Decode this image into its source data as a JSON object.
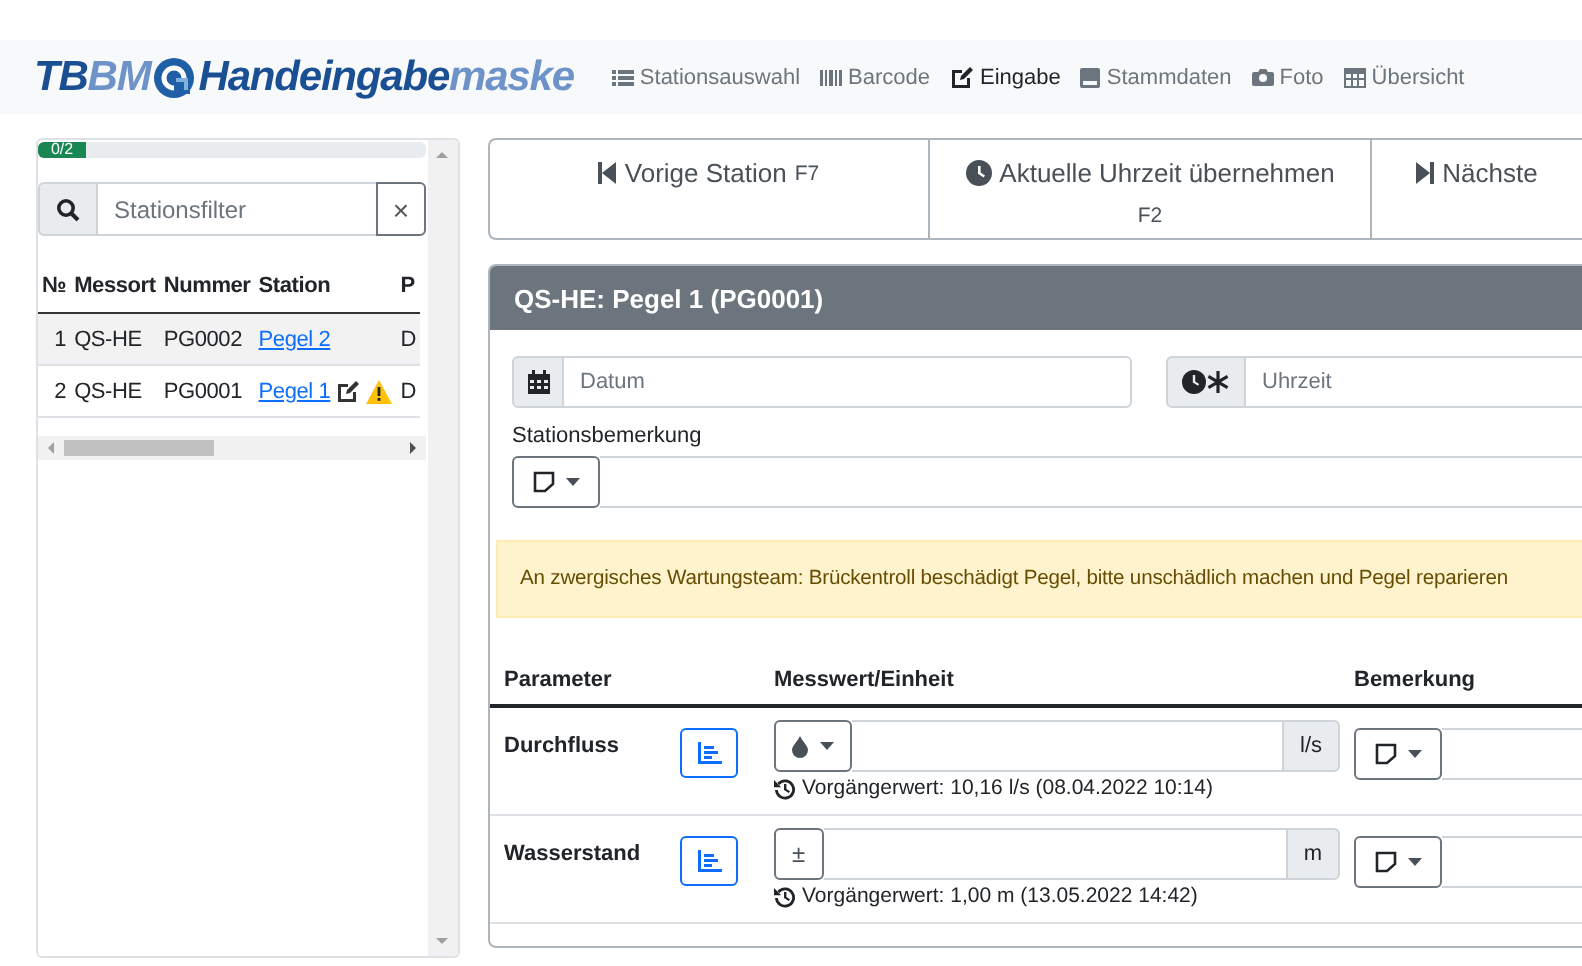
{
  "logo": {
    "brand": [
      {
        "text": "TB",
        "light": false
      },
      {
        "text": "BM",
        "light": true
      }
    ],
    "title": [
      {
        "text": "Handeingabe",
        "light": false
      },
      {
        "text": "maske",
        "light": true
      }
    ]
  },
  "nav": [
    {
      "label": "Stationsauswahl",
      "selected": false
    },
    {
      "label": "Barcode",
      "selected": false
    },
    {
      "label": "Eingabe",
      "selected": true
    },
    {
      "label": "Stammdaten",
      "selected": false
    },
    {
      "label": "Foto",
      "selected": false
    },
    {
      "label": "Übersicht",
      "selected": false
    }
  ],
  "sidebar": {
    "progress": {
      "label": "0/2"
    },
    "search": {
      "placeholder": "Stationsfilter",
      "clear": "×"
    },
    "columns": [
      "№",
      "Messort",
      "Nummer",
      "Station",
      "P"
    ],
    "rows": [
      {
        "no": "1",
        "messort": "QS-HE",
        "nummer": "PG0002",
        "station": "Pegel 2",
        "column_5": "D",
        "edited": false,
        "warning": false
      },
      {
        "no": "2",
        "messort": "QS-HE",
        "nummer": "PG0001",
        "station": "Pegel 1",
        "column_5": "D",
        "edited": true,
        "warning": true
      }
    ]
  },
  "actions": [
    {
      "kind": "prev",
      "label": "Vorige Station",
      "key": "F7"
    },
    {
      "kind": "now",
      "label": "Aktuelle Uhrzeit übernehmen",
      "key": "F2"
    },
    {
      "kind": "next",
      "label": "Nächste"
    }
  ],
  "card": {
    "title": "QS-HE: Pegel 1 (PG0001)",
    "date": {
      "placeholder": "Datum"
    },
    "time": {
      "placeholder": "Uhrzeit"
    },
    "remark_label": "Stationsbemerkung",
    "alert": "An zwergisches Wartungsteam: Brückentroll beschädigt Pegel, bitte unschädlich machen und Pegel reparieren",
    "columns": [
      "Parameter",
      "Messwert/Einheit",
      "Bemerkung"
    ],
    "parameters": [
      {
        "name": "Durchfluss",
        "prefix": {
          "kind": "droplet"
        },
        "unit": "l/s",
        "previous": "Vorgängerwert: 10,16 l/s (08.04.2022 10:14)"
      },
      {
        "name": "Wasserstand",
        "prefix": {
          "kind": "text",
          "text": "±"
        },
        "unit": "m",
        "previous": "Vorgängerwert: 1,00 m (13.05.2022 14:42)"
      }
    ]
  }
}
